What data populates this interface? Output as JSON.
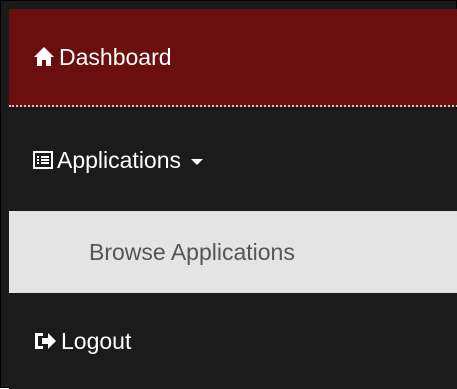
{
  "nav": {
    "dashboard": {
      "label": "Dashboard",
      "icon": "home-icon"
    },
    "applications": {
      "label": "Applications",
      "icon": "list-icon",
      "dropdown_icon": "caret-down-icon"
    },
    "browse_applications": {
      "label": "Browse Applications"
    },
    "logout": {
      "label": "Logout",
      "icon": "logout-icon"
    }
  },
  "colors": {
    "active_bg": "#6a0e0e",
    "menu_bg": "#1b1b1b",
    "submenu_bg": "#e4e4e4",
    "submenu_text": "#555555",
    "text": "#ffffff"
  }
}
